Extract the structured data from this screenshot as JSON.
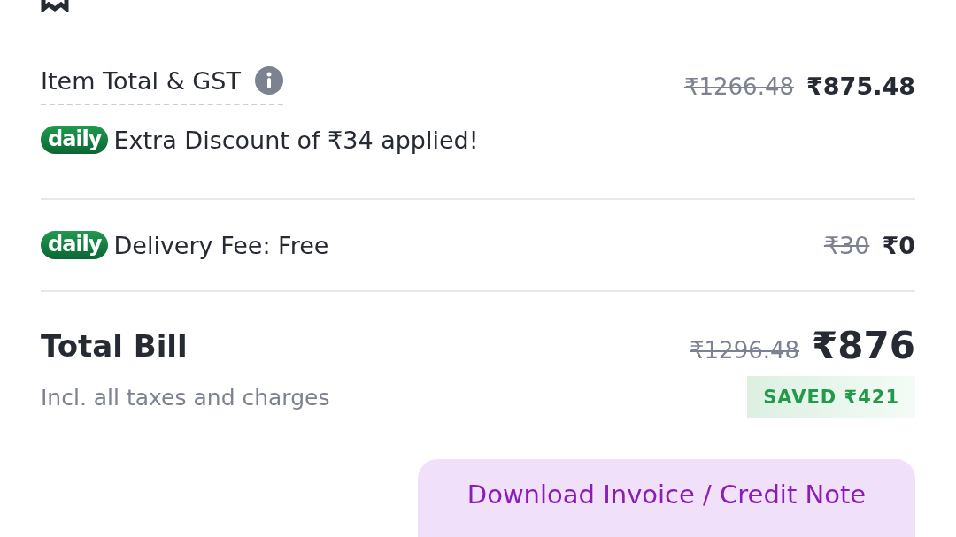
{
  "item_total": {
    "label": "Item Total & GST",
    "original_price": "₹1266.48",
    "price": "₹875.48"
  },
  "discount_note": {
    "badge": "daily",
    "text": "Extra Discount of ₹34 applied!"
  },
  "delivery": {
    "badge": "daily",
    "label": "Delivery Fee: Free",
    "original_price": "₹30",
    "price": "₹0"
  },
  "total": {
    "label": "Total Bill",
    "subtitle": "Incl. all taxes and charges",
    "original_price": "₹1296.48",
    "price": "₹876",
    "saved": "SAVED ₹421"
  },
  "button": {
    "label": "Download Invoice / Credit Note"
  }
}
